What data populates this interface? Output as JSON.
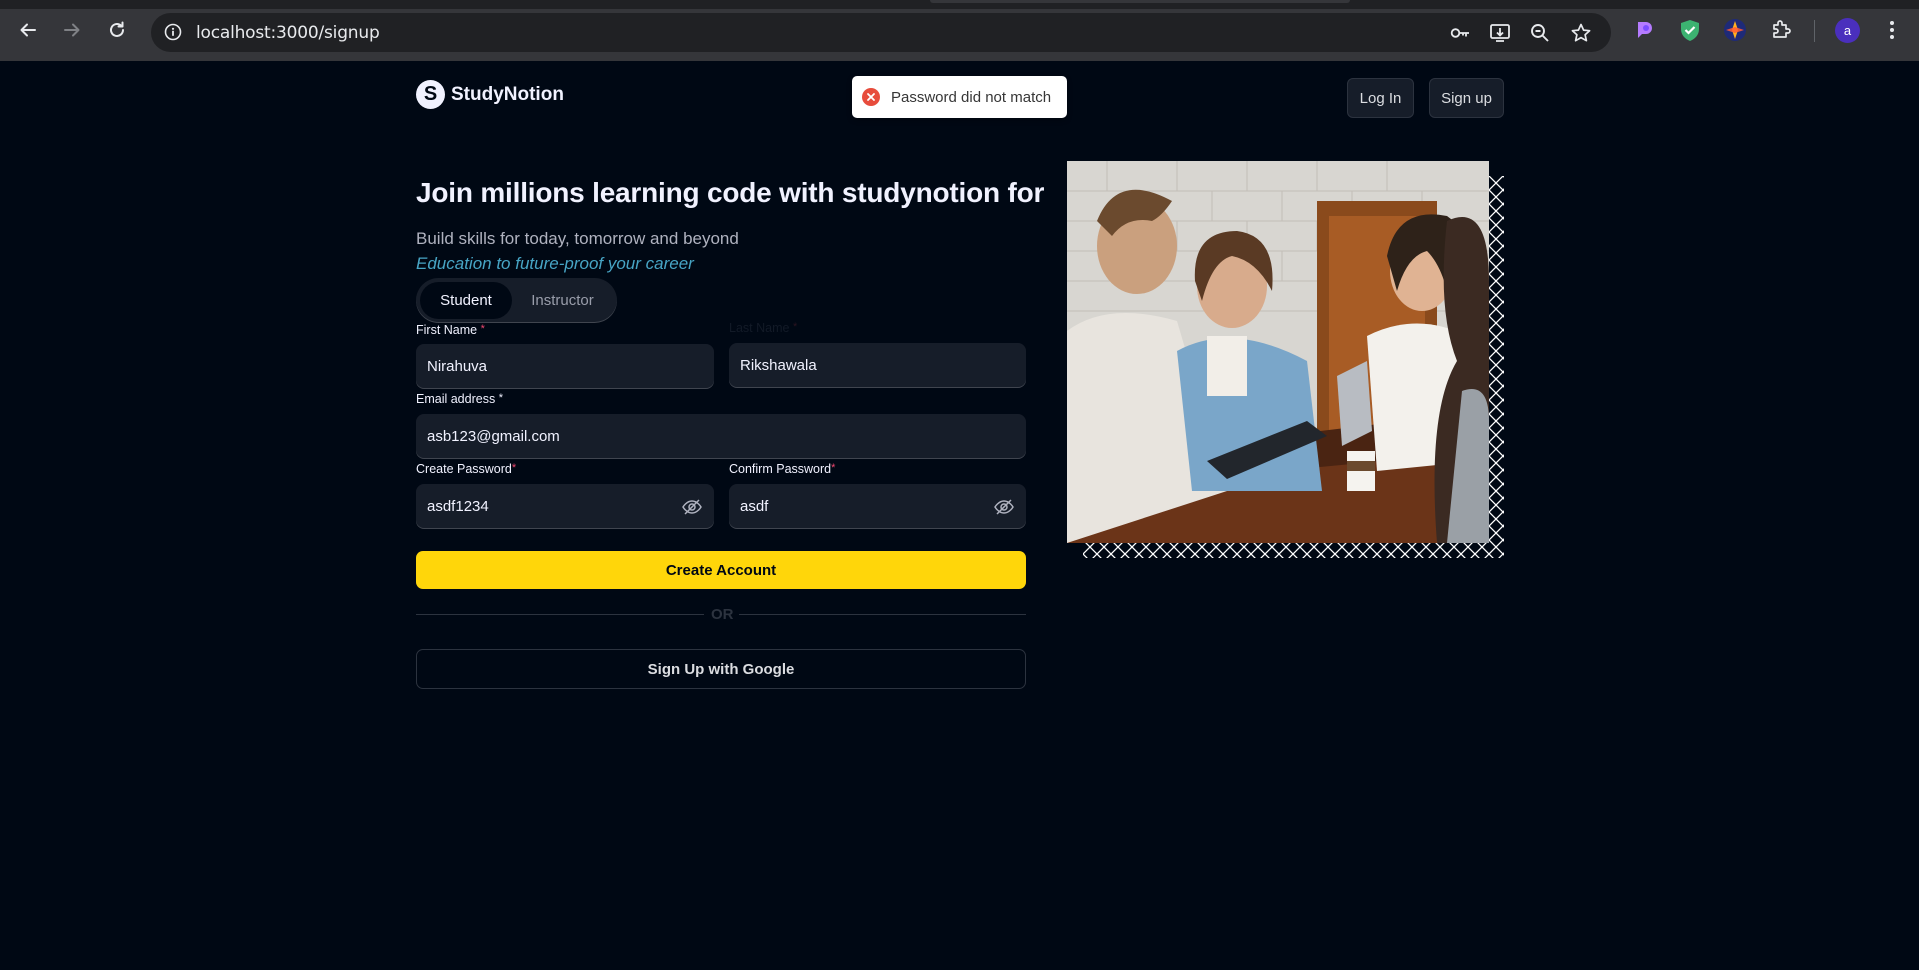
{
  "browser": {
    "url": "localhost:3000/signup",
    "profile_initial": "a"
  },
  "header": {
    "brand_mark": "S",
    "brand_name": "StudyNotion",
    "login_label": "Log In",
    "signup_label": "Sign up"
  },
  "toast": {
    "message": "Password did not match",
    "type": "error"
  },
  "hero": {
    "heading": "Join millions learning code with studynotion for",
    "subtitle": "Build skills for today, tomorrow and beyond",
    "tagline": "Education to future-proof your career"
  },
  "role_tabs": {
    "items": [
      "Student",
      "Instructor"
    ],
    "selected": "Student"
  },
  "form": {
    "first_name": {
      "label": "First Name",
      "value": "Nirahuva"
    },
    "last_name": {
      "label": "Last Name",
      "value": "Rikshawala"
    },
    "email": {
      "label": "Email address",
      "value": "asb123@gmail.com"
    },
    "create_password": {
      "label": "Create Password",
      "value": "asdf1234"
    },
    "confirm_password": {
      "label": "Confirm Password",
      "value": "asdf"
    },
    "required_marker": "*",
    "submit_label": "Create Account",
    "divider_label": "OR",
    "google_label": "Sign Up with Google"
  },
  "colors": {
    "page_bg": "#000814",
    "field_bg": "#161d29",
    "accent_yellow": "#ffd60a",
    "tagline_blue": "#47a5c5",
    "required_pink": "#ef476f",
    "error_red": "#e74c3c"
  }
}
